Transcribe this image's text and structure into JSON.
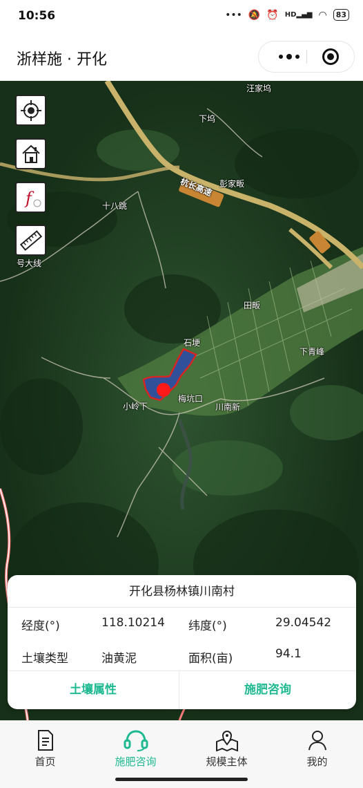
{
  "status_bar": {
    "time": "10:56",
    "network": "HD",
    "battery": "83"
  },
  "nav": {
    "title": "浙样施 · 开化"
  },
  "map": {
    "tools": [
      "locate-icon",
      "home-icon",
      "formula-icon",
      "ruler-icon"
    ],
    "places": {
      "wangjiawu": "汪家坞",
      "xiawu": "下坞",
      "expressway": "杭长高速",
      "pengjiafan": "彭家畈",
      "shibatiao": "十八跳",
      "highway_label": "号大线",
      "tiange": "田畈",
      "shikeng": "石埂",
      "xiaqingya": "下青峰",
      "xiaolingxia": "小岭下",
      "meikengkou": "梅坑口",
      "chuannanxin": "川南新"
    }
  },
  "info_card": {
    "location": "开化县杨林镇川南村",
    "longitude_label": "经度(°)",
    "longitude_value": "118.10214",
    "latitude_label": "纬度(°)",
    "latitude_value": "29.04542",
    "soil_type_label": "土壤类型",
    "soil_type_value": "油黄泥",
    "area_label": "面积(亩)",
    "area_value": "94.1",
    "soil_property_button": "土壤属性",
    "fertilizer_button": "施肥咨询"
  },
  "tab_bar": {
    "active": "施肥咨询",
    "items": [
      {
        "label": "首页",
        "icon": "document-icon"
      },
      {
        "label": "施肥咨询",
        "icon": "headset-icon"
      },
      {
        "label": "规模主体",
        "icon": "map-pin-icon"
      },
      {
        "label": "我的",
        "icon": "user-icon"
      }
    ]
  },
  "colors": {
    "accent": "#1eb991",
    "parcel_fill": "#2f4fa3",
    "parcel_border": "#e02020",
    "marker": "#ff1a1a"
  }
}
